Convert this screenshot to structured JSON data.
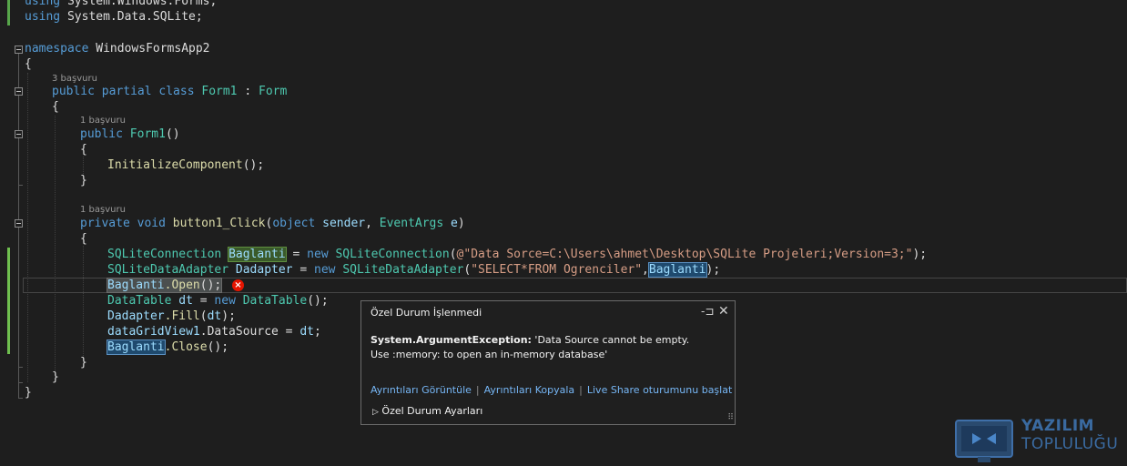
{
  "code": {
    "l0_a": "using",
    "l0_b": " System.Windows.Forms;",
    "l1_a": "using",
    "l1_b": " System.Data.SQLite;",
    "l3_a": "namespace",
    "l3_b": " WindowsFormsApp2",
    "brace_open": "{",
    "brace_close": "}",
    "lens_class": "3 başvuru",
    "l5_kw": "public partial class",
    "l5_type": "Form1",
    "l5_colon": " : ",
    "l5_base": "Form",
    "lens_ctor": "1 başvuru",
    "l7_kw": "public",
    "l7_type": "Form1",
    "l7_rest": "()",
    "l9_fn": "InitializeComponent",
    "l9_rest": "();",
    "lens_click": "1 başvuru",
    "l12_kw1": "private",
    "l12_kw2": "void",
    "l12_fn": "button1_Click",
    "l12_p1": "(",
    "l12_kw3": "object",
    "l12_v1": "sender",
    "l12_c": ", ",
    "l12_t": "EventArgs",
    "l12_v2": "e",
    "l12_p2": ")",
    "l14_t": "SQLiteConnection",
    "l14_v": "Baglanti",
    "l14_eq": " = ",
    "l14_new": "new",
    "l14_t2": "SQLiteConnection",
    "l14_p": "(",
    "l14_str": "@\"Data Sorce=C:\\Users\\ahmet\\Desktop\\SQLite Projeleri;Version=3;\"",
    "l14_end": ");",
    "l15_t": "SQLiteDataAdapter",
    "l15_v": "Dadapter",
    "l15_eq": " = ",
    "l15_new": "new",
    "l15_t2": "SQLiteDataAdapter",
    "l15_p": "(",
    "l15_str": "\"SELECT*FROM Ogrenciler\"",
    "l15_c": ",",
    "l15_v2": "Baglanti",
    "l15_end": ");",
    "l16_v": "Baglanti",
    "l16_fn": ".Open",
    "l16_end": "();",
    "l17_t": "DataTable",
    "l17_v": "dt",
    "l17_eq": " = ",
    "l17_new": "new",
    "l17_t2": "DataTable",
    "l17_end": "();",
    "l18_v": "Dadapter",
    "l18_fn": ".Fill",
    "l18_p": "(",
    "l18_v2": "dt",
    "l18_end": ");",
    "l19_v": "dataGridView1",
    "l19_mid": ".DataSource = ",
    "l19_v2": "dt",
    "l19_end": ";",
    "l20_v": "Baglanti",
    "l20_fn": ".Close",
    "l20_end": "();"
  },
  "exception_popup": {
    "title": "Özel Durum İşlenmedi",
    "exception_type": "System.ArgumentException:",
    "message_line1": " 'Data Source cannot be empty.",
    "message_line2": "Use :memory: to open an in-memory database'",
    "link_details": "Ayrıntıları Görüntüle",
    "link_copy": "Ayrıntıları Kopyala",
    "link_liveshare": "Live Share oturumunu başlat",
    "settings_label": "Özel Durum Ayarları",
    "settings_arrow": "▷",
    "pin_glyph": "-⊐",
    "close_glyph": "✕",
    "grip_glyph": "⠿",
    "separator": "|"
  },
  "error_glyph": "×",
  "watermark": {
    "line1": "YAZILIM",
    "line2": "TOPLULUĞU"
  },
  "colors": {
    "keyword": "#569cd6",
    "type": "#4ec9b0",
    "method": "#dcdcaa",
    "variable": "#9cdcfe",
    "string": "#d69d85",
    "error": "#e51400",
    "link": "#76b6f5"
  }
}
